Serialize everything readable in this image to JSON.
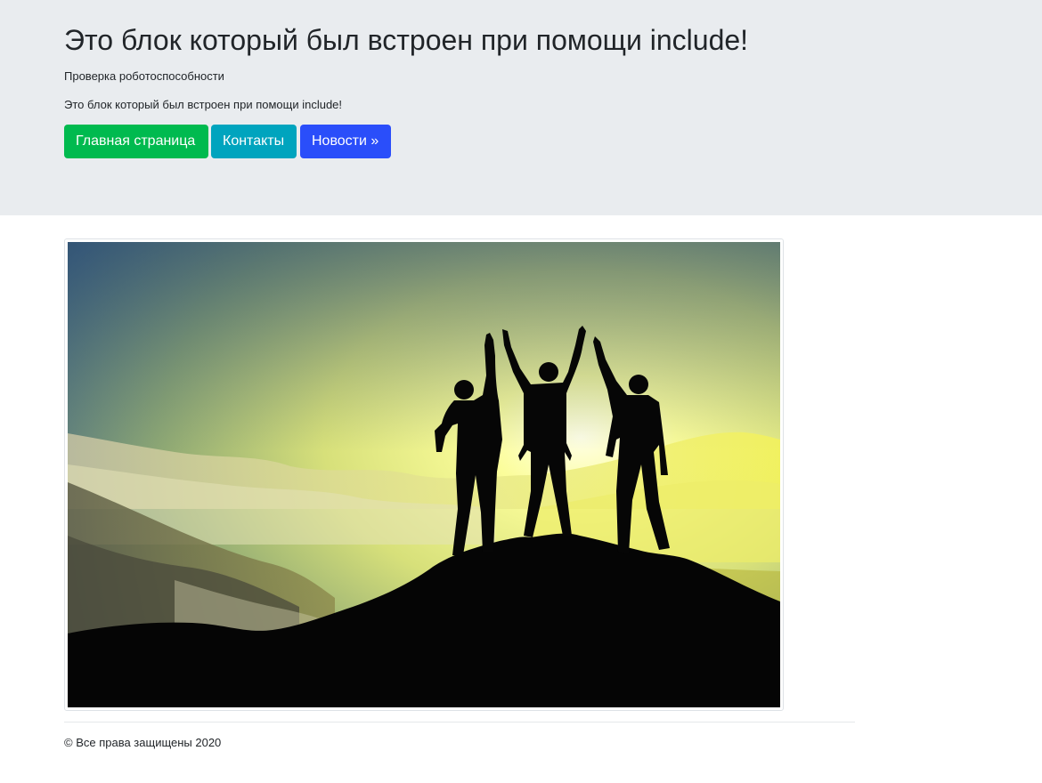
{
  "header": {
    "title": "Это блок который был встроен при помощи include!",
    "subtitle": "Проверка роботоспособности",
    "lead": "Это блок который был встроен при помощи include!"
  },
  "nav_buttons": {
    "home_label": "Главная страница",
    "contacts_label": "Контакты",
    "news_label": "Новости »",
    "home_color": "#00ba4f",
    "contacts_color": "#00a4be",
    "news_color": "#2a4efa"
  },
  "hero_image": {
    "subject": "silhouettes of three people celebrating on a mountain peak at sunset"
  },
  "footer": {
    "copyright": "© Все права защищены 2020"
  }
}
